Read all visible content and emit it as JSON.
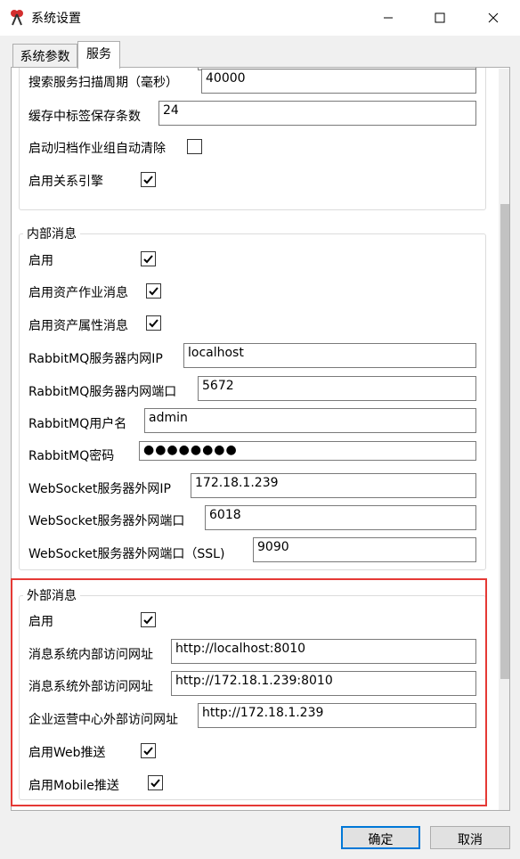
{
  "window": {
    "title": "系统设置"
  },
  "tabs": {
    "params": "系统参数",
    "service": "服务"
  },
  "top_section": {
    "search_period": {
      "label": "搜索服务扫描周期（毫秒）",
      "value": "40000"
    },
    "cache_count": {
      "label": "缓存中标签保存条数",
      "value": "24"
    },
    "auto_clear": {
      "label": "启动归档作业组自动清除",
      "checked": false
    },
    "relation_engine": {
      "label": "启用关系引擎",
      "checked": true
    }
  },
  "internal": {
    "legend": "内部消息",
    "enable": {
      "label": "启用",
      "checked": true
    },
    "asset_job": {
      "label": "启用资产作业消息",
      "checked": true
    },
    "asset_attr": {
      "label": "启用资产属性消息",
      "checked": true
    },
    "mq_ip": {
      "label": "RabbitMQ服务器内网IP",
      "value": "localhost"
    },
    "mq_port": {
      "label": "RabbitMQ服务器内网端口",
      "value": "5672"
    },
    "mq_user": {
      "label": "RabbitMQ用户名",
      "value": "admin"
    },
    "mq_pass": {
      "label": "RabbitMQ密码",
      "value": "●●●●●●●●"
    },
    "ws_ip": {
      "label": "WebSocket服务器外网IP",
      "value": "172.18.1.239"
    },
    "ws_port": {
      "label": "WebSocket服务器外网端口",
      "value": "6018"
    },
    "ws_ssl": {
      "label": "WebSocket服务器外网端口（SSL)",
      "value": "9090"
    }
  },
  "external": {
    "legend": "外部消息",
    "enable": {
      "label": "启用",
      "checked": true
    },
    "inner_url": {
      "label": "消息系统内部访问网址",
      "value": "http://localhost:8010"
    },
    "outer_url": {
      "label": "消息系统外部访问网址",
      "value": "http://172.18.1.239:8010"
    },
    "ops_url": {
      "label": "企业运营中心外部访问网址",
      "value": "http://172.18.1.239"
    },
    "web_push": {
      "label": "启用Web推送",
      "checked": true
    },
    "mobile_push": {
      "label": "启用Mobile推送",
      "checked": true
    }
  },
  "footer": {
    "ok": "确定",
    "cancel": "取消"
  },
  "colors": {
    "highlight": "#e53935",
    "default_button_border": "#0078d7"
  }
}
